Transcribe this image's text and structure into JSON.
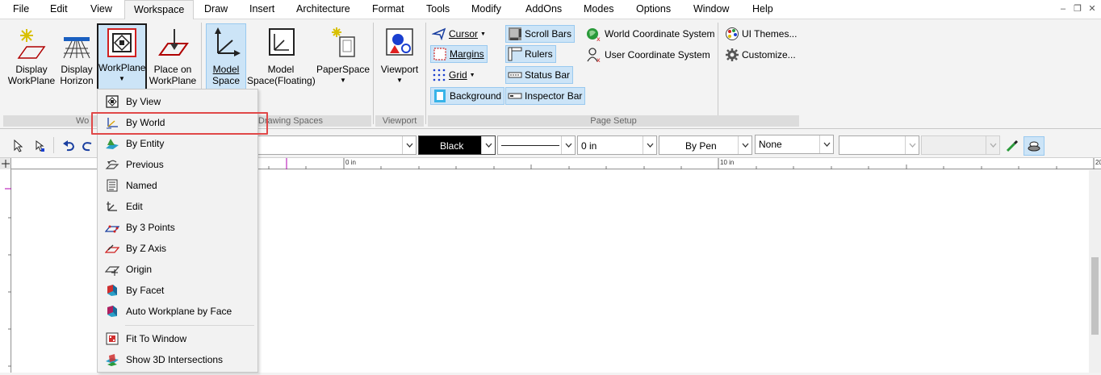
{
  "menubar": {
    "items": [
      "File",
      "Edit",
      "View",
      "Workspace",
      "Draw",
      "Insert",
      "Architecture",
      "Format",
      "Tools",
      "Modify",
      "AddOns",
      "Modes",
      "Options",
      "Window",
      "Help"
    ],
    "active": "Workspace"
  },
  "ribbon": {
    "display_workplane": [
      "Display",
      "WorkPlane"
    ],
    "display_horizon": [
      "Display",
      "Horizon"
    ],
    "workplane": "WorkPlane",
    "place_on_workplane": [
      "Place on",
      "WorkPlane"
    ],
    "model_space": [
      "Model",
      "Space"
    ],
    "model_space_floating": [
      "Model",
      "Space(Floating)"
    ],
    "paperspace": "PaperSpace",
    "viewport": "Viewport",
    "cursor": "Cursor",
    "margins": "Margins",
    "grid": "Grid",
    "background": "Background",
    "scroll_bars": "Scroll Bars",
    "rulers": "Rulers",
    "status_bar": "Status Bar",
    "inspector_bar": "Inspector Bar",
    "world_coordinate_system": "World Coordinate System",
    "user_coordinate_system": "User Coordinate System",
    "ui_themes": "UI Themes...",
    "customize": "Customize...",
    "groups": {
      "workplane_partial": "Wo",
      "drawing_spaces_partial": "Drawing Spaces",
      "viewport": "Viewport",
      "page_setup": "Page Setup"
    }
  },
  "property_bar": {
    "color": "Black",
    "line_width": "0 in",
    "pen": "By Pen",
    "fill": "None"
  },
  "ruler": {
    "labels": [
      "0 in",
      "10 in",
      "20"
    ]
  },
  "dropdown": {
    "items": [
      {
        "label": "By View",
        "icon": "workplane-view-icon"
      },
      {
        "label": "By World",
        "icon": "world-axes-icon",
        "highlighted": true
      },
      {
        "label": "By Entity",
        "icon": "entity-icon"
      },
      {
        "label": "Previous",
        "icon": "previous-icon"
      },
      {
        "label": "Named",
        "icon": "named-icon"
      },
      {
        "label": "Edit",
        "icon": "edit-icon"
      },
      {
        "label": "By 3 Points",
        "icon": "three-points-icon"
      },
      {
        "label": "By Z Axis",
        "icon": "z-axis-icon"
      },
      {
        "label": "Origin",
        "icon": "origin-icon"
      },
      {
        "label": "By Facet",
        "icon": "facet-icon"
      },
      {
        "label": "Auto Workplane by Face",
        "icon": "auto-workplane-icon"
      },
      {
        "label": "Fit To Window",
        "icon": "fit-window-icon"
      },
      {
        "label": "Show 3D Intersections",
        "icon": "intersections-icon"
      }
    ]
  },
  "colors": {
    "selection_bg": "#cce4f7",
    "highlight_border": "#e04848",
    "ruler_marker": "#b000b0"
  }
}
